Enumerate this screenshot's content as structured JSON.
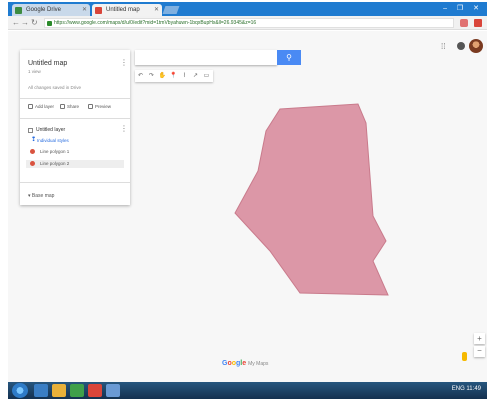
{
  "browser": {
    "tabs": [
      {
        "label": "Google Drive"
      },
      {
        "label": "Untitled map"
      }
    ],
    "window_controls": "– ❐ ✕",
    "url": "https://www.google.com/maps/d/u/0/edit?mid=1tmVbyahuwn-1bqxBupHx&ll=26.9345&z=16"
  },
  "panel": {
    "title": "Untitled map",
    "subtitle": "1 view",
    "status": "All changes saved in Drive",
    "actions": [
      {
        "label": "Add layer"
      },
      {
        "label": "Share"
      },
      {
        "label": "Preview"
      }
    ],
    "layer": {
      "name": "Untitled layer",
      "style_label": "Individual styles",
      "features": [
        "Line polygon 1",
        "Line polygon 2"
      ]
    },
    "basemap_label": "Base map"
  },
  "search": {
    "placeholder": "",
    "button_icon": "search-icon"
  },
  "toolbar": {
    "tools": [
      "↶",
      "↷",
      "✋",
      "📍",
      "⌇",
      "↗",
      "▭"
    ]
  },
  "map": {
    "polygon_fill": "#dc97a7",
    "polygon_stroke": "#c97b8c",
    "background": "#f7f7f7"
  },
  "logo": {
    "text": "Google My Maps"
  },
  "zoom": {
    "in": "+",
    "out": "−"
  },
  "taskbar": {
    "tray_text": "ENG 11:49"
  }
}
